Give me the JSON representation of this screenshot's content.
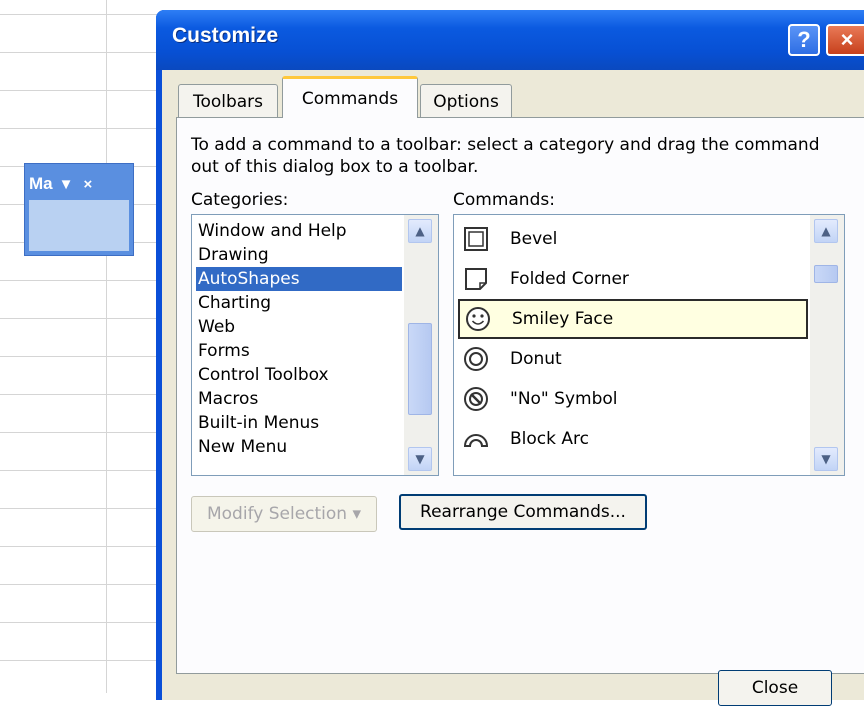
{
  "mini_toolbar": {
    "title": "Ma",
    "dropdown_icon": "▼",
    "close_icon": "×"
  },
  "dialog": {
    "title": "Customize",
    "help_glyph": "?",
    "close_glyph": "×",
    "tabs": [
      "Toolbars",
      "Commands",
      "Options"
    ],
    "active_tab": "Commands",
    "instructions": "To add a command to a toolbar: select a category and drag the command out of this dialog box to a toolbar.",
    "categories_label": "Categories:",
    "commands_label": "Commands:",
    "categories": [
      "Window and Help",
      "Drawing",
      "AutoShapes",
      "Charting",
      "Web",
      "Forms",
      "Control Toolbox",
      "Macros",
      "Built-in Menus",
      "New Menu"
    ],
    "selected_category": "AutoShapes",
    "commands": [
      {
        "label": "Bevel",
        "icon": "bevel-icon"
      },
      {
        "label": "Folded Corner",
        "icon": "folded-corner-icon"
      },
      {
        "label": "Smiley Face",
        "icon": "smiley-face-icon"
      },
      {
        "label": "Donut",
        "icon": "donut-icon"
      },
      {
        "label": "\"No\" Symbol",
        "icon": "no-symbol-icon"
      },
      {
        "label": "Block Arc",
        "icon": "block-arc-icon"
      }
    ],
    "selected_command": "Smiley Face",
    "modify_selection_label": "Modify Selection ▾",
    "rearrange_label": "Rearrange Commands...",
    "close_label": "Close"
  },
  "colors": {
    "title_bar": "#0a55dc",
    "selection": "#316ac5",
    "dialog_bg": "#ece9d8",
    "active_tab_accent": "#ffc83c"
  }
}
